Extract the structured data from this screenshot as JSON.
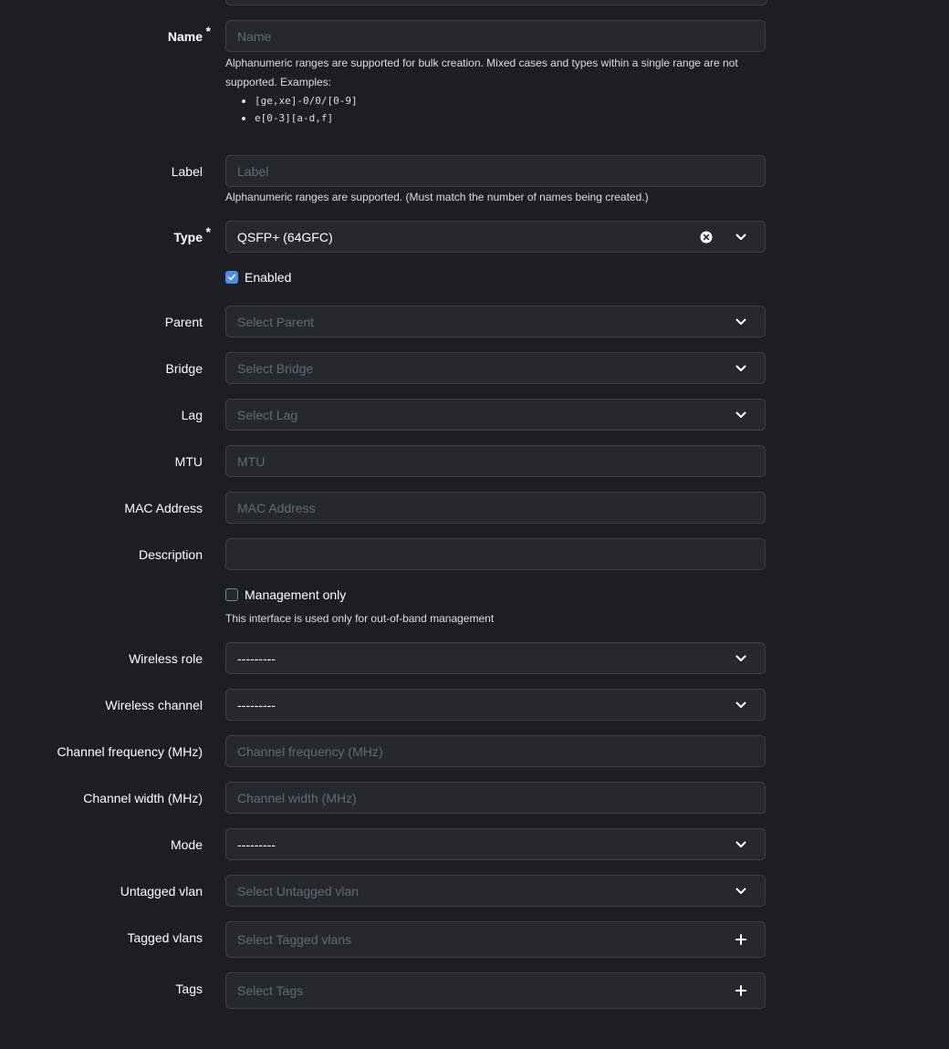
{
  "form": {
    "name": {
      "label": "Name",
      "required_mark": "*",
      "placeholder": "Name",
      "help": "Alphanumeric ranges are supported for bulk creation. Mixed cases and types within a single range are not supported. Examples:",
      "examples": [
        "[ge,xe]-0/0/[0-9]",
        "e[0-3][a-d,f]"
      ]
    },
    "label_field": {
      "label": "Label",
      "placeholder": "Label",
      "help": "Alphanumeric ranges are supported. (Must match the number of names being created.)"
    },
    "type": {
      "label": "Type",
      "required_mark": "*",
      "value": "QSFP+ (64GFC)"
    },
    "enabled": {
      "label": "Enabled",
      "checked": true
    },
    "parent": {
      "label": "Parent",
      "placeholder": "Select Parent"
    },
    "bridge": {
      "label": "Bridge",
      "placeholder": "Select Bridge"
    },
    "lag": {
      "label": "Lag",
      "placeholder": "Select Lag"
    },
    "mtu": {
      "label": "MTU",
      "placeholder": "MTU"
    },
    "mac_address": {
      "label": "MAC Address",
      "placeholder": "MAC Address"
    },
    "description": {
      "label": "Description",
      "placeholder": ""
    },
    "management_only": {
      "label": "Management only",
      "checked": false,
      "help": "This interface is used only for out-of-band management"
    },
    "wireless_role": {
      "label": "Wireless role",
      "value": "---------"
    },
    "wireless_channel": {
      "label": "Wireless channel",
      "value": "---------"
    },
    "channel_frequency": {
      "label": "Channel frequency (MHz)",
      "placeholder": "Channel frequency (MHz)"
    },
    "channel_width": {
      "label": "Channel width (MHz)",
      "placeholder": "Channel width (MHz)"
    },
    "mode": {
      "label": "Mode",
      "value": "---------"
    },
    "untagged_vlan": {
      "label": "Untagged vlan",
      "placeholder": "Select Untagged vlan"
    },
    "tagged_vlans": {
      "label": "Tagged vlans",
      "placeholder": "Select Tagged vlans"
    },
    "tags": {
      "label": "Tags",
      "placeholder": "Select Tags"
    }
  },
  "icons": {
    "dropdown": "chevron-down-icon",
    "clear": "clear-icon",
    "add": "plus-icon",
    "check": "checkmark-icon"
  },
  "colors": {
    "background": "#1b1f23",
    "field_background": "#25292e",
    "field_border": "#3c4148",
    "placeholder": "#636a72",
    "checkbox_checked": "#4c8ff0"
  }
}
